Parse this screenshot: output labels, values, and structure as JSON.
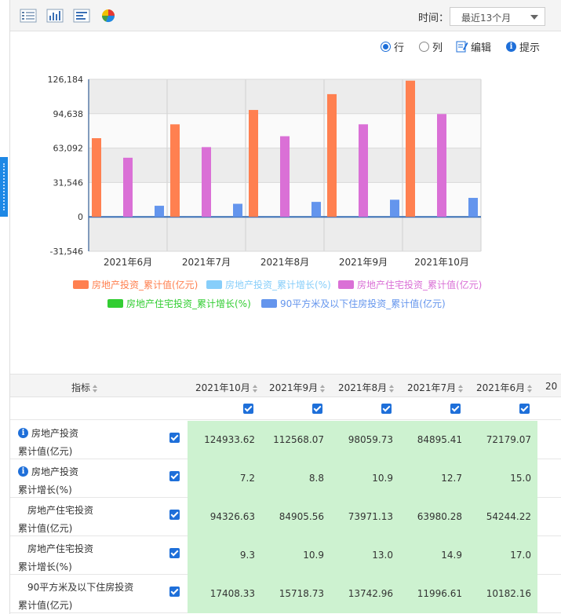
{
  "toolbar": {
    "icons": [
      "table-view-icon",
      "bar-chart-icon",
      "horizontal-bar-icon",
      "pie-chart-icon"
    ],
    "time_label": "时间：",
    "time_value": "最近13个月"
  },
  "options": {
    "row_label": "行",
    "col_label": "列",
    "edit_label": "编辑",
    "hint_label": "提示",
    "selected": "row"
  },
  "chart_data": {
    "type": "bar",
    "categories": [
      "2021年6月",
      "2021年7月",
      "2021年8月",
      "2021年9月",
      "2021年10月"
    ],
    "y_ticks": [
      "126,184",
      "94,638",
      "63,092",
      "31,546",
      "0",
      "-31,546"
    ],
    "ylim": [
      -31546,
      126184
    ],
    "grid": true,
    "legend_position": "bottom",
    "series": [
      {
        "name": "房地产投资_累计值(亿元)",
        "color": "#ff8050",
        "values": [
          72179.07,
          84895.41,
          98059.73,
          112568.07,
          124933.62
        ]
      },
      {
        "name": "房地产投资_累计增长(%)",
        "color": "#87cefa",
        "values": [
          15.0,
          12.7,
          10.9,
          8.8,
          7.2
        ]
      },
      {
        "name": "房地产住宅投资_累计值(亿元)",
        "color": "#da70d6",
        "values": [
          54244.22,
          63980.28,
          73971.13,
          84905.56,
          94326.63
        ]
      },
      {
        "name": "房地产住宅投资_累计增长(%)",
        "color": "#32cd32",
        "values": [
          17.0,
          14.9,
          13.0,
          10.9,
          9.3
        ]
      },
      {
        "name": "90平方米及以下住房投资_累计值(亿元)",
        "color": "#6495ed",
        "values": [
          10182.16,
          11996.61,
          13742.96,
          15718.73,
          17408.33
        ]
      }
    ]
  },
  "table": {
    "header_label": "指标",
    "columns": [
      "2021年10月",
      "2021年9月",
      "2021年8月",
      "2021年7月",
      "2021年6月"
    ],
    "truncated_column": "20",
    "rows": [
      {
        "line1": "房地产投资",
        "line2": "累计值(亿元)",
        "info": true,
        "values": [
          "124933.62",
          "112568.07",
          "98059.73",
          "84895.41",
          "72179.07"
        ]
      },
      {
        "line1": "房地产投资",
        "line2": "累计增长(%)",
        "info": true,
        "values": [
          "7.2",
          "8.8",
          "10.9",
          "12.7",
          "15.0"
        ]
      },
      {
        "line1": "房地产住宅投资",
        "line2": "累计值(亿元)",
        "info": false,
        "values": [
          "94326.63",
          "84905.56",
          "73971.13",
          "63980.28",
          "54244.22"
        ]
      },
      {
        "line1": "房地产住宅投资",
        "line2": "累计增长(%)",
        "info": false,
        "values": [
          "9.3",
          "10.9",
          "13.0",
          "14.9",
          "17.0"
        ]
      },
      {
        "line1": "90平方米及以下住房投资",
        "line2": "累计值(亿元)",
        "info": false,
        "values": [
          "17408.33",
          "15718.73",
          "13742.96",
          "11996.61",
          "10182.16"
        ]
      }
    ]
  }
}
